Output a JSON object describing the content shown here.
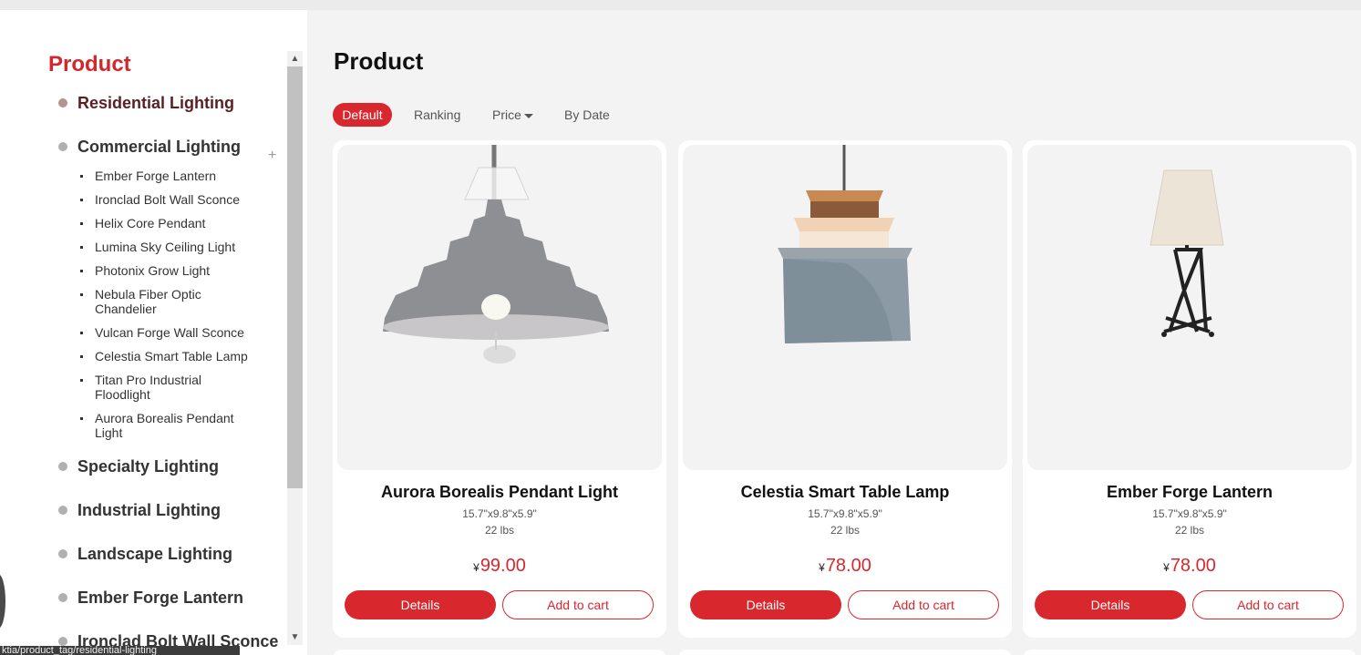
{
  "sidebar": {
    "title": "Product",
    "categories": [
      {
        "label": "Residential Lighting"
      },
      {
        "label": "Commercial Lighting",
        "toggle": "+"
      },
      {
        "label": "Specialty Lighting"
      },
      {
        "label": "Industrial Lighting"
      },
      {
        "label": "Landscape Lighting"
      },
      {
        "label": "Ember Forge Lantern"
      },
      {
        "label": "Ironclad Bolt Wall Sconce"
      }
    ],
    "subitems": [
      "Ember Forge Lantern",
      "Ironclad Bolt Wall Sconce",
      "Helix Core Pendant",
      "Lumina Sky Ceiling Light",
      "Photonix Grow Light",
      "Nebula Fiber Optic Chandelier",
      "Vulcan Forge Wall Sconce",
      "Celestia Smart Table Lamp",
      "Titan Pro Industrial Floodlight",
      "Aurora Borealis Pendant Light"
    ]
  },
  "main": {
    "title": "Product",
    "sort": {
      "default": "Default",
      "ranking": "Ranking",
      "price": "Price",
      "date": "By Date"
    },
    "products": [
      {
        "name": "Aurora Borealis Pendant Light",
        "dimensions": "15.7\"x9.8\"x5.9\"",
        "weight": "22 lbs",
        "currency": "¥",
        "price": "99.00",
        "details": "Details",
        "cart": "Add to cart",
        "icon": "pendant-light-icon"
      },
      {
        "name": "Celestia Smart Table Lamp",
        "dimensions": "15.7\"x9.8\"x5.9\"",
        "weight": "22 lbs",
        "currency": "¥",
        "price": "78.00",
        "details": "Details",
        "cart": "Add to cart",
        "icon": "drum-pendant-icon"
      },
      {
        "name": "Ember Forge Lantern",
        "dimensions": "15.7\"x9.8\"x5.9\"",
        "weight": "22 lbs",
        "currency": "¥",
        "price": "78.00",
        "details": "Details",
        "cart": "Add to cart",
        "icon": "table-lamp-icon"
      }
    ]
  },
  "status_bar": {
    "text": "ktia/product_tag/residential-lighting"
  },
  "colors": {
    "accent": "#d8272d",
    "background": "#f3f3f3",
    "sidebar": "#ffffff"
  }
}
